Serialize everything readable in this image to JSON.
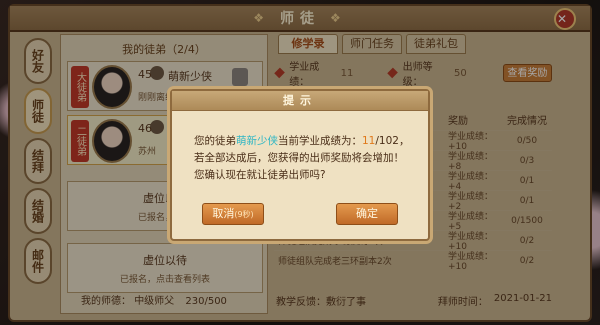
{
  "window": {
    "title": "师徒"
  },
  "side_tabs": [
    "好友",
    "师徒",
    "结拜",
    "结婚",
    "邮件"
  ],
  "left": {
    "heading": "我的徒弟（2/4）",
    "disciples": [
      {
        "seal": "大徒弟",
        "level": "45",
        "name": "萌新少侠",
        "sub": "刚刚离线"
      },
      {
        "seal": "二徒弟",
        "level": "46",
        "name": "",
        "sub": "苏州"
      }
    ],
    "slots": [
      {
        "title": "虚位以待",
        "sub": "已报名，点击"
      },
      {
        "title": "虚位以待",
        "sub": "已报名，点击查看列表"
      }
    ],
    "footer": {
      "label": "我的师德：",
      "rank": "中级师父",
      "value": "230/500"
    }
  },
  "right": {
    "tabs": [
      "修学录",
      "师门任务",
      "徒弟礼包"
    ],
    "info": {
      "study_label": "学业成绩：",
      "study_value": "11",
      "grad_label": "出师等级：",
      "grad_value": "50",
      "view_button": "查看奖励"
    },
    "columns": [
      "",
      "奖励",
      "完成情况"
    ],
    "rows": [
      {
        "task": "",
        "reward": "学业成绩：+10",
        "status": "0/50"
      },
      {
        "task": "",
        "reward": "学业成绩：+8",
        "status": "0/3"
      },
      {
        "task": "",
        "reward": "学业成绩：+4",
        "status": "0/1"
      },
      {
        "task": "",
        "reward": "学业成绩：+2",
        "status": "0/1"
      },
      {
        "task": "",
        "reward": "学业成绩：+5",
        "status": "0/1500"
      },
      {
        "task": "师徒组队完成珍珑棋局2次",
        "reward": "学业成绩：+10",
        "status": "0/2"
      },
      {
        "task": "师徒组队完成老三环副本2次",
        "reward": "学业成绩：+10",
        "status": "0/2"
      }
    ],
    "footer": {
      "label": "教学反馈：",
      "value": "敷衍了事",
      "date_label": "拜师时间：",
      "date": "2021-01-21"
    }
  },
  "dialog": {
    "title": "提示",
    "text_1": "您的徒弟",
    "name": "萌新少侠",
    "text_2": "当前学业成绩为：",
    "score": "11",
    "total": "/102",
    "text_3": "，若全部达成后，您获得的出师奖励将会增加！您确认现在就让徒弟出师吗?",
    "cancel": "取消",
    "cancel_timer": "(9秒)",
    "confirm": "确定"
  }
}
